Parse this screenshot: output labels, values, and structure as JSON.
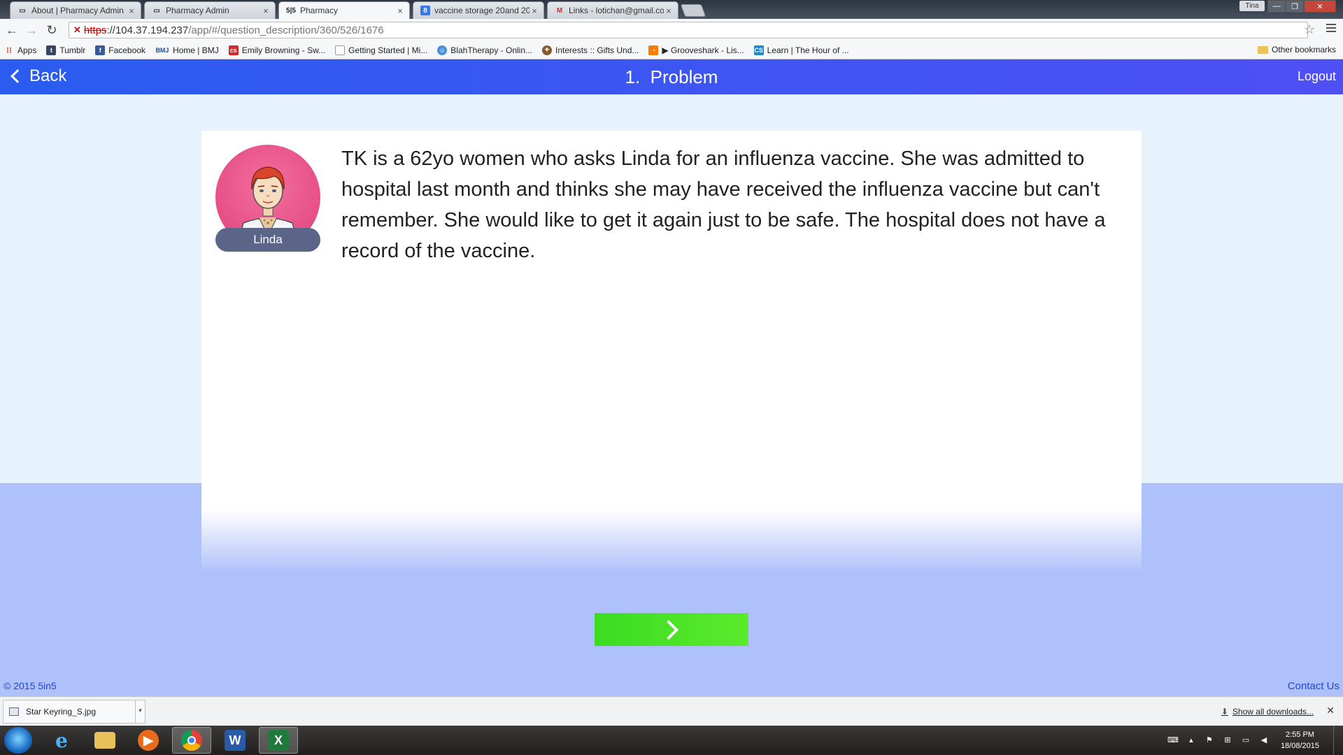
{
  "browser": {
    "tabs": [
      {
        "title": "About | Pharmacy Admin",
        "favicon": "page-icon",
        "active": false
      },
      {
        "title": "Pharmacy Admin",
        "favicon": "page-icon",
        "active": false
      },
      {
        "title": "Pharmacy",
        "favicon": "5in5-logo-icon",
        "favicon_text": "5|5",
        "active": true
      },
      {
        "title": "vaccine storage 20and 20",
        "favicon": "google-icon",
        "favicon_text": "8",
        "active": false
      },
      {
        "title": "Links - lotichan@gmail.co",
        "favicon": "gmail-icon",
        "favicon_text": "M",
        "active": false
      }
    ],
    "profile_name": "Tina",
    "url": {
      "scheme": "https",
      "rest": "://104.37.194.237",
      "path": "/app/#/question_description/360/526/1676"
    },
    "bookmarks": [
      {
        "label": "Apps",
        "icon": "apps-grid-icon",
        "color": "#d83b2f"
      },
      {
        "label": "Tumblr",
        "icon": "tumblr-icon",
        "color": "#36465d"
      },
      {
        "label": "Facebook",
        "icon": "facebook-icon",
        "color": "#3b5998"
      },
      {
        "label": "Home | BMJ",
        "icon": "bmj-icon",
        "color": "#1d4a9a"
      },
      {
        "label": "Emily Browning - Sw...",
        "icon": "cs-icon",
        "color": "#d8262c"
      },
      {
        "label": "Getting Started | Mi...",
        "icon": "page-icon",
        "color": "#888888"
      },
      {
        "label": "BlahTherapy - Onlin...",
        "icon": "chat-icon",
        "color": "#4a90d9"
      },
      {
        "label": "Interests :: Gifts Und...",
        "icon": "gift-icon",
        "color": "#8a5a2b"
      },
      {
        "label": "▶ Grooveshark - Lis...",
        "icon": "grooveshark-icon",
        "color": "#f77f00"
      },
      {
        "label": "Learn | The Hour of ...",
        "icon": "code-icon",
        "color": "#1e88c8"
      }
    ],
    "other_bookmarks": "Other bookmarks"
  },
  "app": {
    "back_label": "Back",
    "title": "1.  Problem",
    "logout_label": "Logout",
    "character_name": "Linda",
    "problem_text": "TK is a 62yo women who asks Linda for an influenza vaccine. She was admitted to hospital last month and thinks she may have received the influenza vaccine but can't remember. She would like to get it again just to be safe. The hospital does not have a record of the vaccine.",
    "copyright": "© 2015 5in5",
    "contact_label": "Contact Us"
  },
  "downloads": {
    "file_name": "Star Keyring_S.jpg",
    "show_all_label": "Show all downloads..."
  },
  "taskbar": {
    "apps": [
      {
        "name": "internet-explorer",
        "glyph": "e",
        "color": "#1e7fd8"
      },
      {
        "name": "file-explorer",
        "glyph": "",
        "color": "#e8c15a"
      },
      {
        "name": "media-player",
        "glyph": "▶",
        "color": "#e86a1a"
      },
      {
        "name": "chrome",
        "glyph": "",
        "color": "#3aa757"
      },
      {
        "name": "word",
        "glyph": "W",
        "color": "#2a5ba8"
      },
      {
        "name": "excel",
        "glyph": "X",
        "color": "#1f7a3c"
      }
    ],
    "time": "2:55 PM",
    "date": "18/08/2015"
  }
}
